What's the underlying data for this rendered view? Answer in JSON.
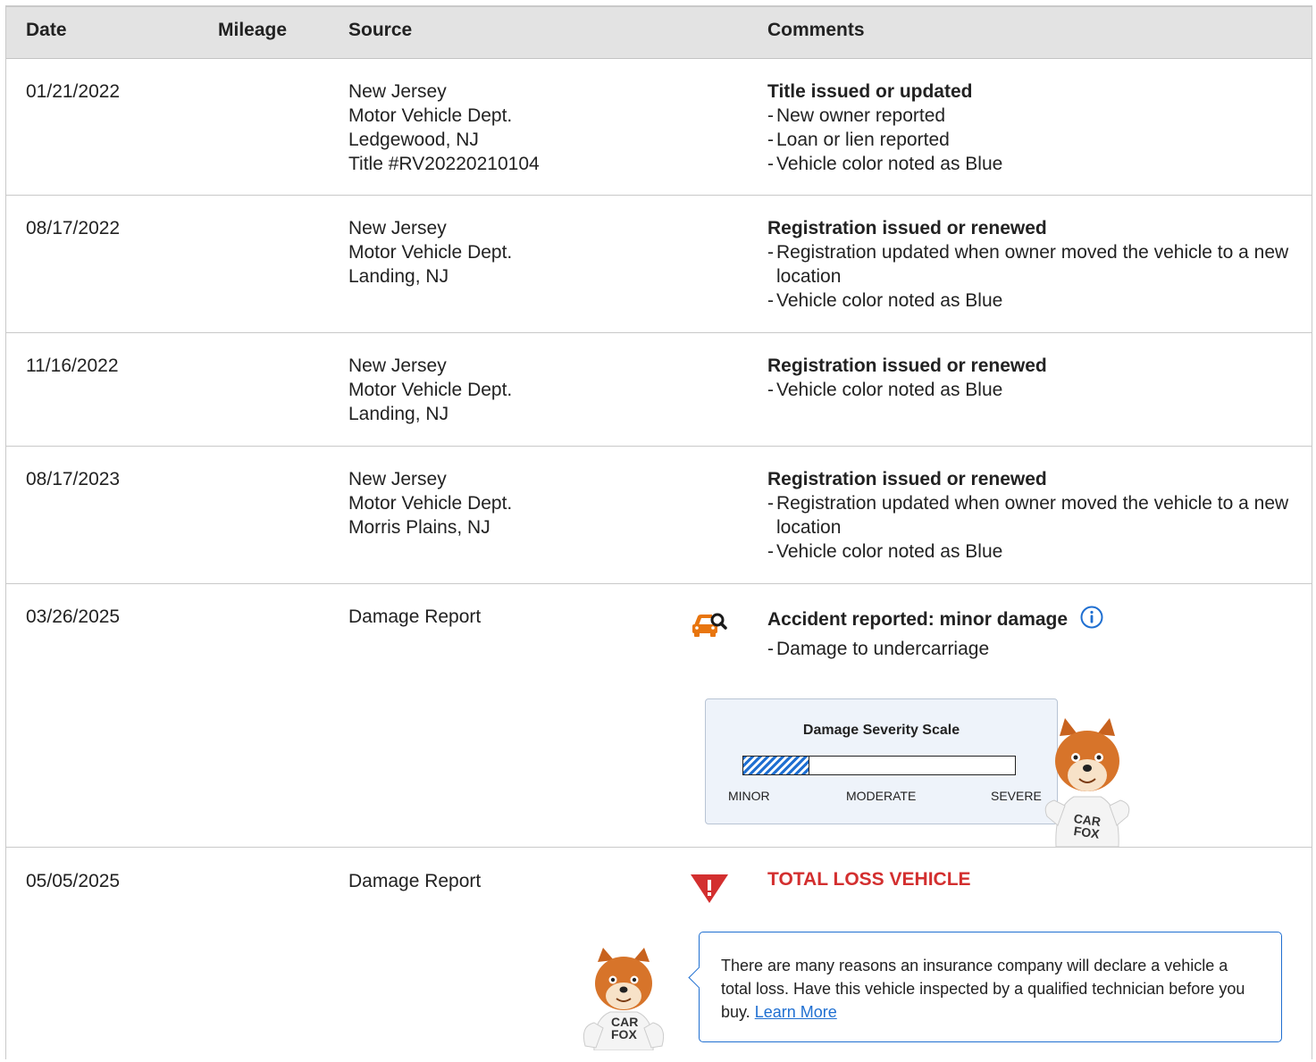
{
  "table": {
    "headers": {
      "date": "Date",
      "mileage": "Mileage",
      "source": "Source",
      "comments": "Comments"
    },
    "rows": [
      {
        "date": "01/21/2022",
        "source": [
          "New Jersey",
          "Motor Vehicle Dept.",
          "Ledgewood, NJ",
          "Title #RV20220210104"
        ],
        "title": "Title issued or updated",
        "bullets": [
          "New owner reported",
          "Loan or lien reported",
          "Vehicle color noted as Blue"
        ]
      },
      {
        "date": "08/17/2022",
        "source": [
          "New Jersey",
          "Motor Vehicle Dept.",
          "Landing, NJ"
        ],
        "title": "Registration issued or renewed",
        "bullets": [
          "Registration updated when owner moved the vehicle to a new location",
          "Vehicle color noted as Blue"
        ]
      },
      {
        "date": "11/16/2022",
        "source": [
          "New Jersey",
          "Motor Vehicle Dept.",
          "Landing, NJ"
        ],
        "title": "Registration issued or renewed",
        "bullets": [
          "Vehicle color noted as Blue"
        ]
      },
      {
        "date": "08/17/2023",
        "source": [
          "New Jersey",
          "Motor Vehicle Dept.",
          "Morris Plains, NJ"
        ],
        "title": "Registration issued or renewed",
        "bullets": [
          "Registration updated when owner moved the vehicle to a new location",
          "Vehicle color noted as Blue"
        ]
      },
      {
        "date": "03/26/2025",
        "source": [
          "Damage Report"
        ],
        "title": "Accident reported: minor damage",
        "bullets": [
          "Damage to undercarriage"
        ],
        "icon": "car-damage-search-icon",
        "severity": {
          "title": "Damage Severity Scale",
          "level": 0.24,
          "labels": {
            "minor": "MINOR",
            "moderate": "MODERATE",
            "severe": "SEVERE"
          }
        }
      },
      {
        "date": "05/05/2025",
        "source": [
          "Damage Report"
        ],
        "title": "TOTAL LOSS VEHICLE",
        "icon": "warning-triangle-icon",
        "callout": {
          "text": "There are many reasons an insurance company will declare a vehicle a total loss. Have this vehicle inspected by a qualified technician before you buy.",
          "link": "Learn More"
        }
      }
    ]
  },
  "mascot_shirt_text": "CAR FOX",
  "colors": {
    "header_bg": "#e3e3e3",
    "accent_blue": "#1f6fd1",
    "alert_red": "#d32f2f",
    "damage_orange": "#e8750e"
  }
}
